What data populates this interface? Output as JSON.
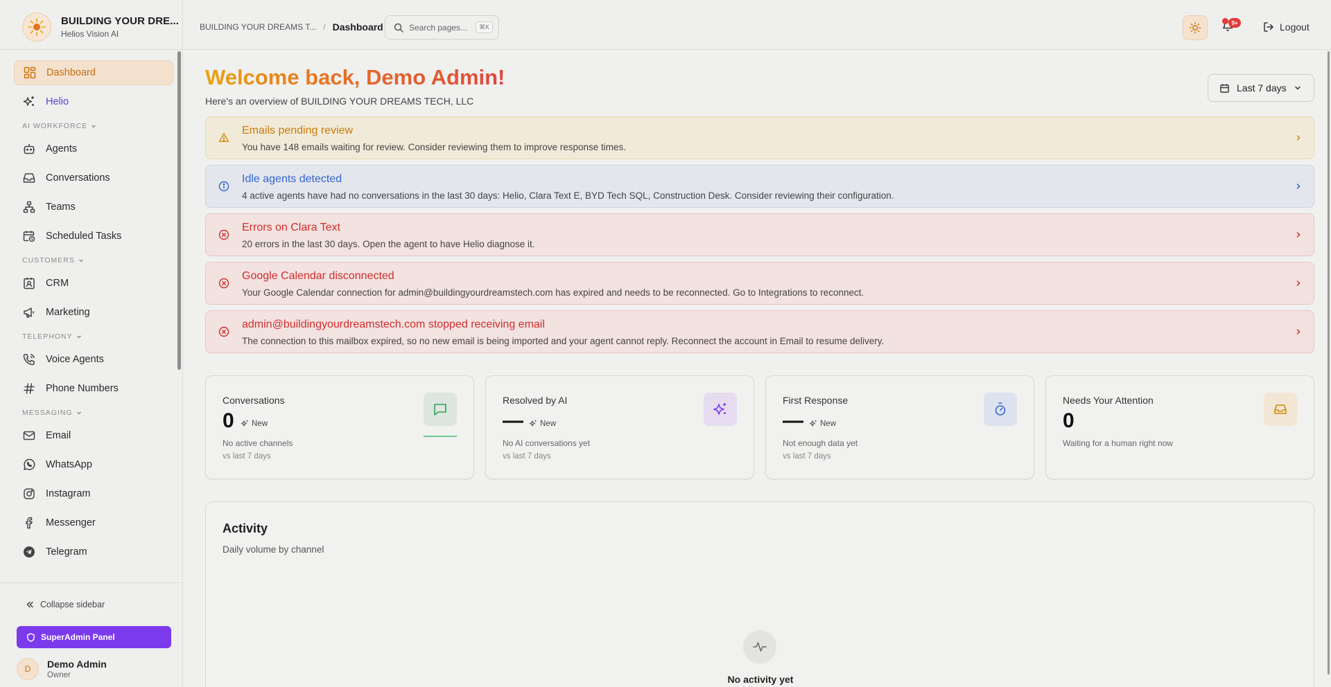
{
  "brand": {
    "title": "BUILDING YOUR DRE...",
    "subtitle": "Helios Vision AI"
  },
  "sidebar": {
    "items": [
      {
        "label": "Dashboard"
      },
      {
        "label": "Helio"
      }
    ],
    "sections": {
      "ai_workforce": {
        "title": "AI WORKFORCE",
        "items": [
          "Agents",
          "Conversations",
          "Teams",
          "Scheduled Tasks"
        ]
      },
      "customers": {
        "title": "CUSTOMERS",
        "items": [
          "CRM",
          "Marketing"
        ]
      },
      "telephony": {
        "title": "TELEPHONY",
        "items": [
          "Voice Agents",
          "Phone Numbers"
        ]
      },
      "messaging": {
        "title": "MESSAGING",
        "items": [
          "Email",
          "WhatsApp",
          "Instagram",
          "Messenger",
          "Telegram"
        ]
      }
    },
    "collapse_label": "Collapse sidebar",
    "superadmin_label": "SuperAdmin Panel",
    "user": {
      "initial": "D",
      "name": "Demo Admin",
      "role": "Owner"
    }
  },
  "topbar": {
    "breadcrumb_root": "BUILDING YOUR DREAMS T...",
    "breadcrumb_current": "Dashboard",
    "search_placeholder": "Search pages...",
    "search_shortcut": "⌘K",
    "notifications_badge": "9+",
    "logout_label": "Logout"
  },
  "main": {
    "welcome": "Welcome back, Demo Admin!",
    "overview": "Here's an overview of BUILDING YOUR DREAMS TECH, LLC",
    "date_range": "Last 7 days",
    "alerts": [
      {
        "type": "warning",
        "title": "Emails pending review",
        "desc": "You have 148 emails waiting for review. Consider reviewing them to improve response times."
      },
      {
        "type": "info",
        "title": "Idle agents detected",
        "desc": "4 active agents have had no conversations in the last 30 days: Helio, Clara Text E, BYD Tech SQL, Construction Desk. Consider reviewing their configuration."
      },
      {
        "type": "error",
        "title": "Errors on Clara Text",
        "desc": "20 errors in the last 30 days. Open the agent to have Helio diagnose it."
      },
      {
        "type": "error",
        "title": "Google Calendar disconnected",
        "desc": "Your Google Calendar connection for admin@buildingyourdreamstech.com has expired and needs to be reconnected. Go to Integrations to reconnect."
      },
      {
        "type": "error",
        "title": "admin@buildingyourdreamstech.com stopped receiving email",
        "desc": "The connection to this mailbox expired, so no new email is being imported and your agent cannot reply. Reconnect the account in Email to resume delivery."
      }
    ],
    "stats": [
      {
        "label": "Conversations",
        "value": "0",
        "badge": "New",
        "desc": "No active channels",
        "vs": "vs last 7 days"
      },
      {
        "label": "Resolved by AI",
        "value": "—",
        "badge": "New",
        "desc": "No AI conversations yet",
        "vs": "vs last 7 days"
      },
      {
        "label": "First Response",
        "value": "—",
        "badge": "New",
        "desc": "Not enough data yet",
        "vs": "vs last 7 days"
      },
      {
        "label": "Needs Your Attention",
        "value": "0",
        "desc": "Waiting for a human right now"
      }
    ],
    "activity": {
      "title": "Activity",
      "subtitle": "Daily volume by channel",
      "empty": "No activity yet"
    }
  },
  "colors": {
    "accent": "#d07410",
    "helio": "#5b3fd3",
    "superadmin": "#7c3aed",
    "error": "#d12d2d",
    "info": "#3264d2",
    "warning": "#c97b0a"
  }
}
